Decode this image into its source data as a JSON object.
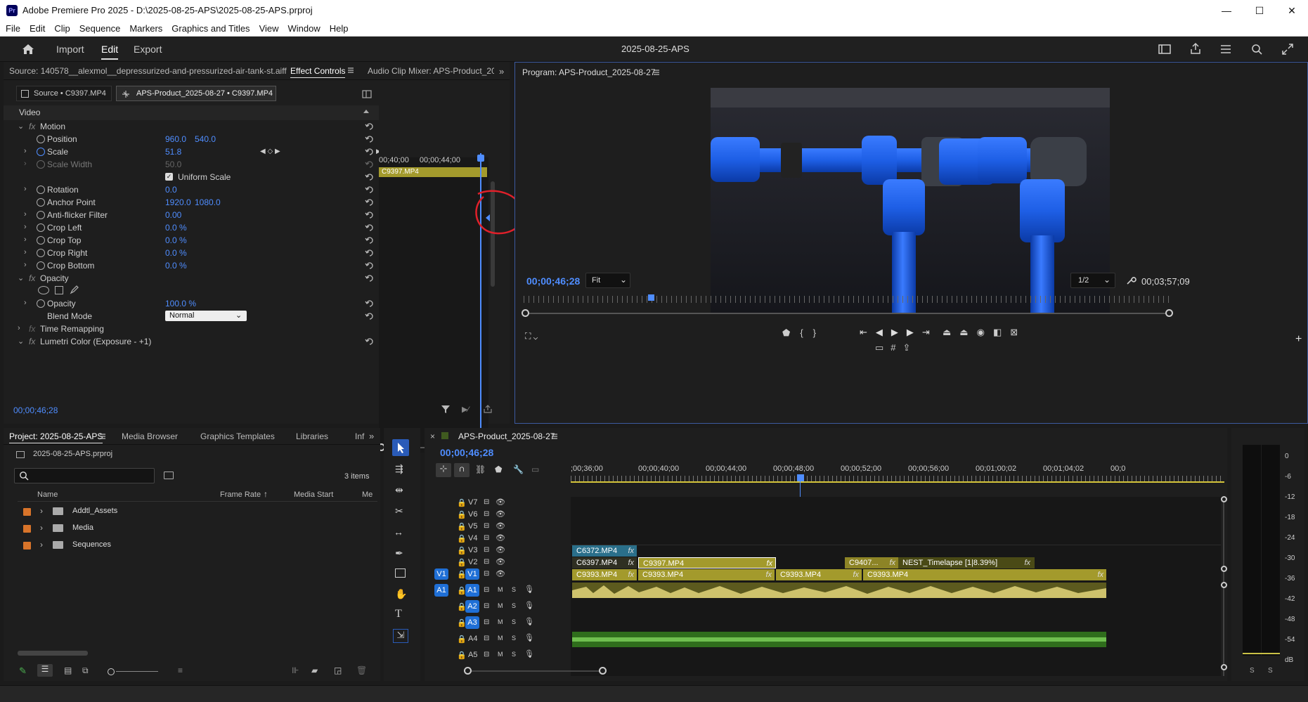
{
  "titlebar": {
    "app_icon": "Pr",
    "title": "Adobe Premiere Pro 2025 - D:\\2025-08-25-APS\\2025-08-25-APS.prproj",
    "minimize": "—",
    "maximize": "☐",
    "close": "✕"
  },
  "menu": [
    "File",
    "Edit",
    "Clip",
    "Sequence",
    "Markers",
    "Graphics and Titles",
    "View",
    "Window",
    "Help"
  ],
  "workspace": {
    "tabs": [
      "Import",
      "Edit",
      "Export"
    ],
    "active_tab": "Edit",
    "project_title": "2025-08-25-APS"
  },
  "source_panel": {
    "tabs": [
      "Source: 140578__alexmol__depressurized-and-pressurized-air-tank-st.aiff",
      "Effect Controls",
      "Audio Clip Mixer: APS-Product_2025-"
    ],
    "active_tab": "Effect Controls",
    "subtab_source": "Source • C9397.MP4",
    "subtab_seq": "APS-Product_2025-08-27 • C9397.MP4",
    "ruler": [
      "00;40;00",
      "00;00;44;00"
    ],
    "clip_label": "C9397.MP4",
    "timecode": "00;00;46;28",
    "section_video": "Video",
    "rows": [
      {
        "name": "Motion",
        "type": "fx"
      },
      {
        "name": "Position",
        "v1": "960.0",
        "v2": "540.0"
      },
      {
        "name": "Scale",
        "v1": "51.8"
      },
      {
        "name": "Scale Width",
        "v1": "50.0",
        "dim": true
      },
      {
        "name": "Uniform Scale",
        "type": "check"
      },
      {
        "name": "Rotation",
        "v1": "0.0"
      },
      {
        "name": "Anchor Point",
        "v1": "1920.0",
        "v2": "1080.0"
      },
      {
        "name": "Anti-flicker Filter",
        "v1": "0.00"
      },
      {
        "name": "Crop Left",
        "v1": "0.0 %"
      },
      {
        "name": "Crop Top",
        "v1": "0.0 %"
      },
      {
        "name": "Crop Right",
        "v1": "0.0 %"
      },
      {
        "name": "Crop Bottom",
        "v1": "0.0 %"
      },
      {
        "name": "Opacity",
        "type": "fx"
      },
      {
        "name": "masks",
        "type": "masks"
      },
      {
        "name": "Opacity",
        "v1": "100.0 %"
      },
      {
        "name": "Blend Mode",
        "type": "select",
        "v1": "Normal"
      },
      {
        "name": "Time Remapping",
        "type": "fx-collapsed"
      },
      {
        "name": "Lumetri Color (Exposure - +1)",
        "type": "fx"
      }
    ]
  },
  "program": {
    "title": "Program: APS-Product_2025-08-27",
    "timecode": "00;00;46;28",
    "fit": "Fit",
    "resolution": "1/2",
    "duration": "00;03;57;09"
  },
  "project": {
    "tabs": [
      "Project: 2025-08-25-APS",
      "Media Browser",
      "Graphics Templates",
      "Libraries",
      "Inf"
    ],
    "file": "2025-08-25-APS.prproj",
    "items_count": "3 items",
    "search_placeholder": "",
    "columns": [
      "Name",
      "Frame Rate",
      "Media Start",
      "Me"
    ],
    "items": [
      {
        "name": "Addtl_Assets",
        "color": "#e8782c"
      },
      {
        "name": "Media",
        "color": "#e8782c"
      },
      {
        "name": "Sequences",
        "color": "#e8782c"
      }
    ]
  },
  "timeline": {
    "title": "APS-Product_2025-08-27",
    "timecode": "00;00;46;28",
    "ruler": [
      ";00;36;00",
      "00;00;40;00",
      "00;00;44;00",
      "00;00;48;00",
      "00;00;52;00",
      "00;00;56;00",
      "00;01;00;02",
      "00;01;04;02",
      "00;0"
    ],
    "video_tracks": [
      "V7",
      "V6",
      "V5",
      "V4",
      "V3",
      "V2",
      "V1"
    ],
    "audio_tracks": [
      "A1",
      "A2",
      "A3",
      "A4",
      "A5"
    ],
    "clips": {
      "v3": [
        "C6372.MP4"
      ],
      "v2": [
        "C6397.MP4",
        "C9397.MP4",
        "C9407...",
        "NEST_Timelapse [1|8.39%]"
      ],
      "v1": [
        "C9393.MP4",
        "C9393.MP4",
        "C9393.MP4",
        "C9393.MP4"
      ]
    },
    "fx": "fx",
    "m": "M",
    "s": "S"
  },
  "meter": {
    "scale": [
      "0",
      "-6",
      "-12",
      "-18",
      "-24",
      "-30",
      "-36",
      "-42",
      "-48",
      "-54",
      "dB"
    ],
    "solo": [
      "S",
      "S"
    ]
  },
  "colors": {
    "accent": "#1f6fd6",
    "clip_video": "#a39a2c",
    "clip_audio_green": "#3f9a2a",
    "annotation_red": "#e0202a"
  }
}
